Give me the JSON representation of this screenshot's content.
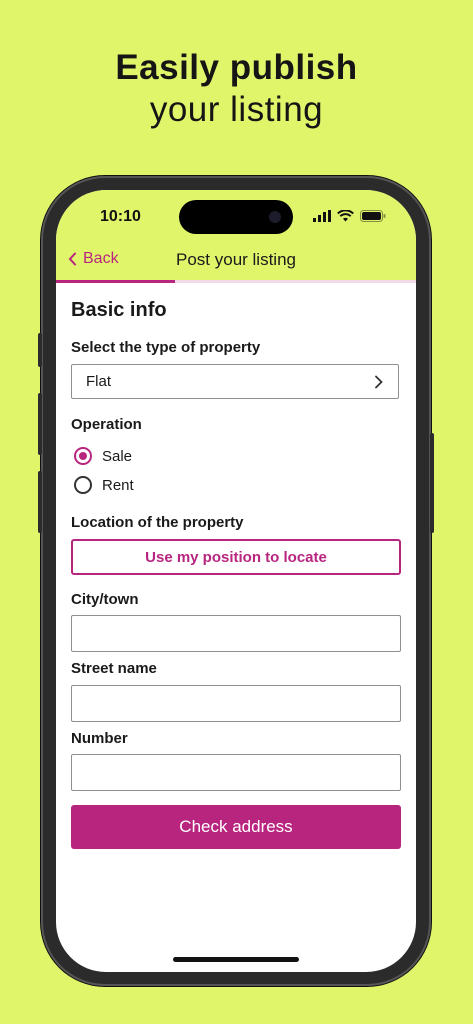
{
  "headline": {
    "line1": "Easily publish",
    "line2": "your listing"
  },
  "status_bar": {
    "time": "10:10",
    "icons": [
      "signal-icon",
      "wifi-icon",
      "battery-icon"
    ]
  },
  "nav": {
    "back_label": "Back",
    "title": "Post your listing",
    "progress": 0.33
  },
  "form": {
    "section_title": "Basic info",
    "property_type": {
      "label": "Select the type of property",
      "value": "Flat"
    },
    "operation": {
      "label": "Operation",
      "options": [
        {
          "label": "Sale",
          "selected": true
        },
        {
          "label": "Rent",
          "selected": false
        }
      ]
    },
    "location": {
      "label": "Location of the property",
      "locate_button": "Use my position to locate"
    },
    "city": {
      "label": "City/town",
      "value": ""
    },
    "street": {
      "label": "Street name",
      "value": ""
    },
    "number": {
      "label": "Number",
      "value": ""
    },
    "submit_label": "Check address"
  },
  "colors": {
    "background": "#e1f56b",
    "accent": "#b8257f"
  }
}
